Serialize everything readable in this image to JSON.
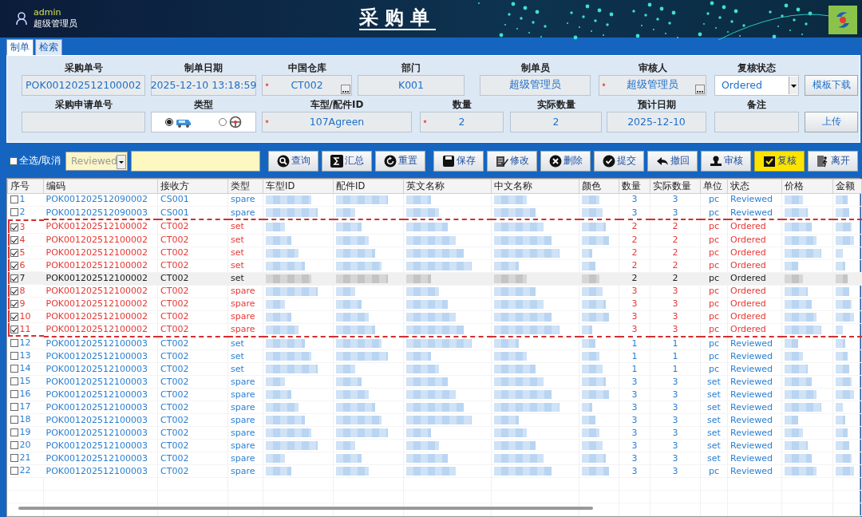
{
  "header": {
    "user": "admin",
    "role": "超级管理员",
    "title": "采购单"
  },
  "tabs": [
    {
      "label": "制单",
      "selected": true
    },
    {
      "label": "检索",
      "selected": false
    }
  ],
  "form": {
    "rows": [
      {
        "fields": [
          {
            "label": "采购单号",
            "kind": "text",
            "value": "POK001202512100002",
            "required": false
          },
          {
            "label": "制单日期",
            "kind": "text",
            "value": "2025-12-10 13:18:59",
            "required": false
          },
          {
            "label": "中国仓库",
            "kind": "lookup",
            "value": "CT002",
            "required": true
          },
          {
            "label": "部门",
            "kind": "text",
            "value": "K001",
            "required": false
          },
          {
            "label": "制单员",
            "kind": "text",
            "value": "超级管理员",
            "required": false
          },
          {
            "label": "审核人",
            "kind": "lookup",
            "value": "超级管理员",
            "required": true
          },
          {
            "label": "复核状态",
            "kind": "select",
            "value": "Ordered",
            "required": false
          }
        ],
        "button": "模板下载"
      },
      {
        "fields": [
          {
            "label": "采购申请单号",
            "kind": "text",
            "required": false
          },
          {
            "label": "类型",
            "kind": "radio",
            "options": [
              {
                "selected": true
              },
              {
                "selected": false
              }
            ],
            "required": false
          },
          {
            "label": "车型/配件ID",
            "kind": "text",
            "value": "107Agreen",
            "required": true
          },
          {
            "label": "数量",
            "kind": "text",
            "value": "2",
            "required": true
          },
          {
            "label": "实际数量",
            "kind": "text",
            "value": "2",
            "required": false
          },
          {
            "label": "预计日期",
            "kind": "text",
            "value": "2025-12-10",
            "required": false
          },
          {
            "label": "备注",
            "kind": "text",
            "required": false
          }
        ],
        "button": "上传"
      }
    ]
  },
  "toolbar": {
    "select_all": {
      "label": "全选/取消",
      "checked": false
    },
    "status_filter": {
      "value": "Reviewed"
    },
    "groups": [
      [
        {
          "label": "查询",
          "selected": false
        },
        {
          "label": "汇总",
          "selected": false
        },
        {
          "label": "重置",
          "selected": false
        }
      ],
      [
        {
          "label": "保存",
          "selected": false
        },
        {
          "label": "修改",
          "selected": false
        },
        {
          "label": "删除",
          "selected": false
        },
        {
          "label": "提交",
          "selected": false
        },
        {
          "label": "撤回",
          "selected": false
        },
        {
          "label": "审核",
          "selected": false
        },
        {
          "label": "复核",
          "selected": true
        },
        {
          "label": "离开",
          "selected": false
        }
      ]
    ]
  },
  "table": {
    "columns": [
      "序号",
      "编码",
      "接收方",
      "类型",
      "车型ID",
      "配件ID",
      "英文名称",
      "中文名称",
      "颜色",
      "数量",
      "实际数量",
      "单位",
      "状态",
      "价格",
      "金额"
    ],
    "rows": [
      {
        "no": "1",
        "code": "POK001202512090002",
        "receiver": "CS001",
        "type": "spare",
        "qty": "3",
        "actual_qty": "3",
        "unit": "pc",
        "status": "Reviewed",
        "checked": false,
        "selected": false
      },
      {
        "no": "2",
        "code": "POK001202512090003",
        "receiver": "CS001",
        "type": "spare",
        "qty": "3",
        "actual_qty": "3",
        "unit": "pc",
        "status": "Reviewed",
        "checked": false,
        "selected": false
      },
      {
        "no": "3",
        "code": "POK001202512100002",
        "receiver": "CT002",
        "type": "set",
        "qty": "2",
        "actual_qty": "2",
        "unit": "pc",
        "status": "Ordered",
        "checked": true,
        "selected": false
      },
      {
        "no": "4",
        "code": "POK001202512100002",
        "receiver": "CT002",
        "type": "set",
        "qty": "2",
        "actual_qty": "2",
        "unit": "pc",
        "status": "Ordered",
        "checked": true,
        "selected": false
      },
      {
        "no": "5",
        "code": "POK001202512100002",
        "receiver": "CT002",
        "type": "set",
        "qty": "2",
        "actual_qty": "2",
        "unit": "pc",
        "status": "Ordered",
        "checked": true,
        "selected": false
      },
      {
        "no": "6",
        "code": "POK001202512100002",
        "receiver": "CT002",
        "type": "set",
        "qty": "2",
        "actual_qty": "2",
        "unit": "pc",
        "status": "Ordered",
        "checked": true,
        "selected": false
      },
      {
        "no": "7",
        "code": "POK001202512100002",
        "receiver": "CT002",
        "type": "set",
        "qty": "2",
        "actual_qty": "2",
        "unit": "pc",
        "status": "Ordered",
        "checked": true,
        "selected": true
      },
      {
        "no": "8",
        "code": "POK001202512100002",
        "receiver": "CT002",
        "type": "spare",
        "qty": "3",
        "actual_qty": "3",
        "unit": "pc",
        "status": "Ordered",
        "checked": true,
        "selected": false
      },
      {
        "no": "9",
        "code": "POK001202512100002",
        "receiver": "CT002",
        "type": "spare",
        "qty": "3",
        "actual_qty": "3",
        "unit": "pc",
        "status": "Ordered",
        "checked": true,
        "selected": false
      },
      {
        "no": "10",
        "code": "POK001202512100002",
        "receiver": "CT002",
        "type": "spare",
        "qty": "3",
        "actual_qty": "3",
        "unit": "pc",
        "status": "Ordered",
        "checked": true,
        "selected": false
      },
      {
        "no": "11",
        "code": "POK001202512100002",
        "receiver": "CT002",
        "type": "spare",
        "qty": "3",
        "actual_qty": "3",
        "unit": "pc",
        "status": "Ordered",
        "checked": true,
        "selected": false
      },
      {
        "no": "12",
        "code": "POK001202512100003",
        "receiver": "CT002",
        "type": "set",
        "qty": "1",
        "actual_qty": "1",
        "unit": "pc",
        "status": "Reviewed",
        "checked": false,
        "selected": false
      },
      {
        "no": "13",
        "code": "POK001202512100003",
        "receiver": "CT002",
        "type": "set",
        "qty": "1",
        "actual_qty": "1",
        "unit": "pc",
        "status": "Reviewed",
        "checked": false,
        "selected": false
      },
      {
        "no": "14",
        "code": "POK001202512100003",
        "receiver": "CT002",
        "type": "set",
        "qty": "1",
        "actual_qty": "1",
        "unit": "pc",
        "status": "Reviewed",
        "checked": false,
        "selected": false
      },
      {
        "no": "15",
        "code": "POK001202512100003",
        "receiver": "CT002",
        "type": "spare",
        "qty": "3",
        "actual_qty": "3",
        "unit": "set",
        "status": "Reviewed",
        "checked": false,
        "selected": false
      },
      {
        "no": "16",
        "code": "POK001202512100003",
        "receiver": "CT002",
        "type": "spare",
        "qty": "3",
        "actual_qty": "3",
        "unit": "set",
        "status": "Reviewed",
        "checked": false,
        "selected": false
      },
      {
        "no": "17",
        "code": "POK001202512100003",
        "receiver": "CT002",
        "type": "spare",
        "qty": "3",
        "actual_qty": "3",
        "unit": "set",
        "status": "Reviewed",
        "checked": false,
        "selected": false
      },
      {
        "no": "18",
        "code": "POK001202512100003",
        "receiver": "CT002",
        "type": "spare",
        "qty": "3",
        "actual_qty": "3",
        "unit": "set",
        "status": "Reviewed",
        "checked": false,
        "selected": false
      },
      {
        "no": "19",
        "code": "POK001202512100003",
        "receiver": "CT002",
        "type": "spare",
        "qty": "3",
        "actual_qty": "3",
        "unit": "set",
        "status": "Reviewed",
        "checked": false,
        "selected": false
      },
      {
        "no": "20",
        "code": "POK001202512100003",
        "receiver": "CT002",
        "type": "spare",
        "qty": "3",
        "actual_qty": "3",
        "unit": "set",
        "status": "Reviewed",
        "checked": false,
        "selected": false
      },
      {
        "no": "21",
        "code": "POK001202512100003",
        "receiver": "CT002",
        "type": "spare",
        "qty": "3",
        "actual_qty": "3",
        "unit": "set",
        "status": "Reviewed",
        "checked": false,
        "selected": false
      },
      {
        "no": "22",
        "code": "POK001202512100003",
        "receiver": "CT002",
        "type": "spare",
        "qty": "3",
        "actual_qty": "3",
        "unit": "pc",
        "status": "Reviewed",
        "checked": false,
        "selected": false
      }
    ]
  }
}
